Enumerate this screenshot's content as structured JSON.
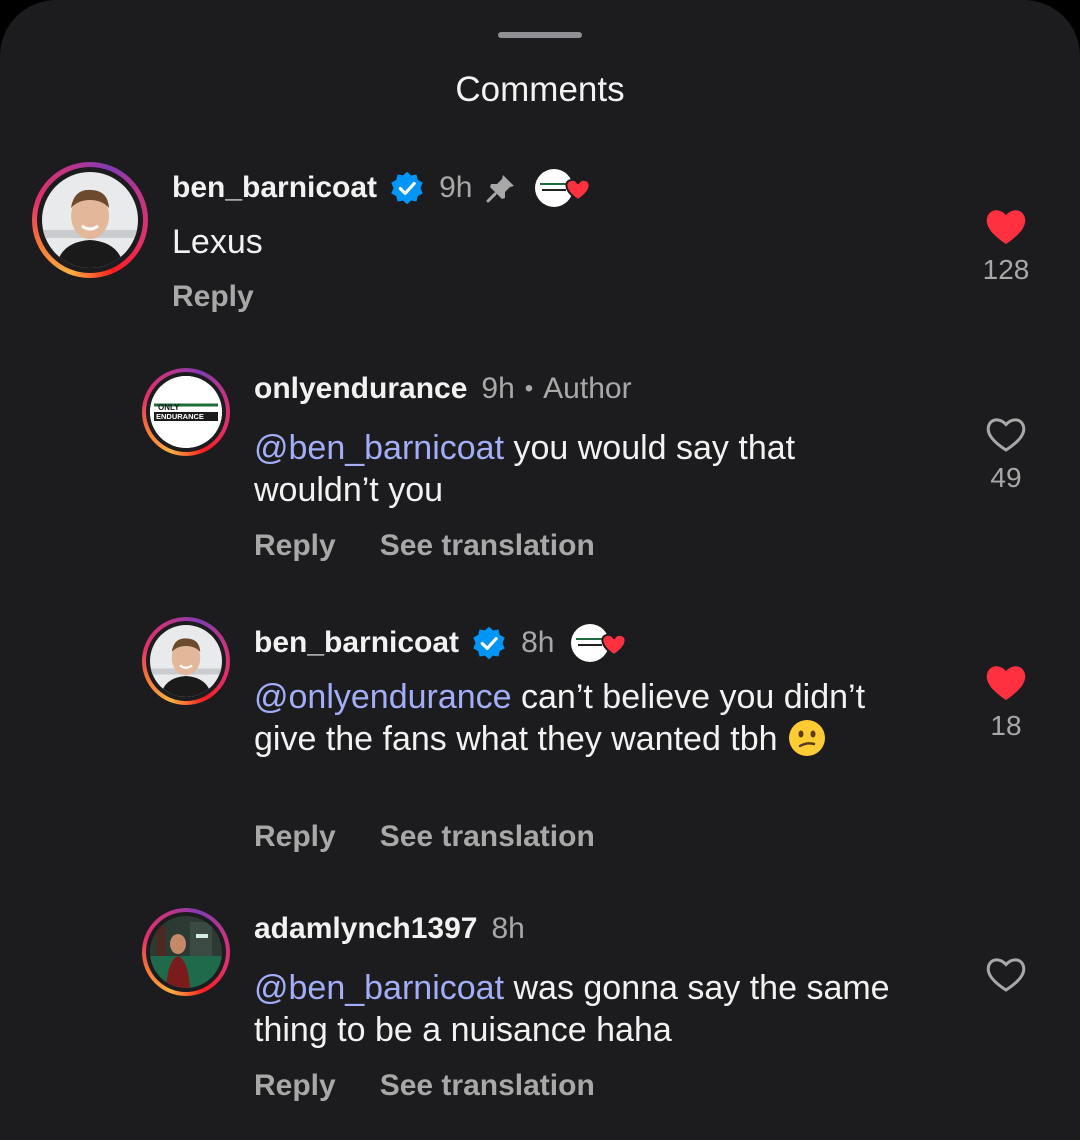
{
  "header": {
    "title": "Comments"
  },
  "comments": [
    {
      "username": "ben_barnicoat",
      "time": "9h",
      "pinned": true,
      "liked_by_creator": true,
      "text": "Lexus",
      "reply_label": "Reply",
      "like_count": "128",
      "liked": true
    },
    {
      "username": "onlyendurance",
      "time": "9h",
      "separator": "•",
      "author_label": "Author",
      "mention": "@ben_barnicoat",
      "text": " you would say that wouldn’t you",
      "reply_label": "Reply",
      "translate_label": "See translation",
      "like_count": "49",
      "liked": false,
      "avatar_text_1": "ONLY",
      "avatar_text_2": "ENDURANCE"
    },
    {
      "username": "ben_barnicoat",
      "time": "8h",
      "liked_by_creator": true,
      "mention": "@onlyendurance",
      "text": " can’t believe you didn’t give the fans what they wanted tbh",
      "emoji": "confused-face",
      "reply_label": "Reply",
      "translate_label": "See translation",
      "like_count": "18",
      "liked": true
    },
    {
      "username": "adamlynch1397",
      "time": "8h",
      "mention": "@ben_barnicoat",
      "text": " was gonna say the same thing to be a nuisance haha",
      "reply_label": "Reply",
      "translate_label": "See translation",
      "liked": false
    }
  ],
  "colors": {
    "background": "#1c1c1e",
    "mention": "#a3aef8",
    "like_red": "#ff3040",
    "verified_blue": "#0095f6"
  }
}
